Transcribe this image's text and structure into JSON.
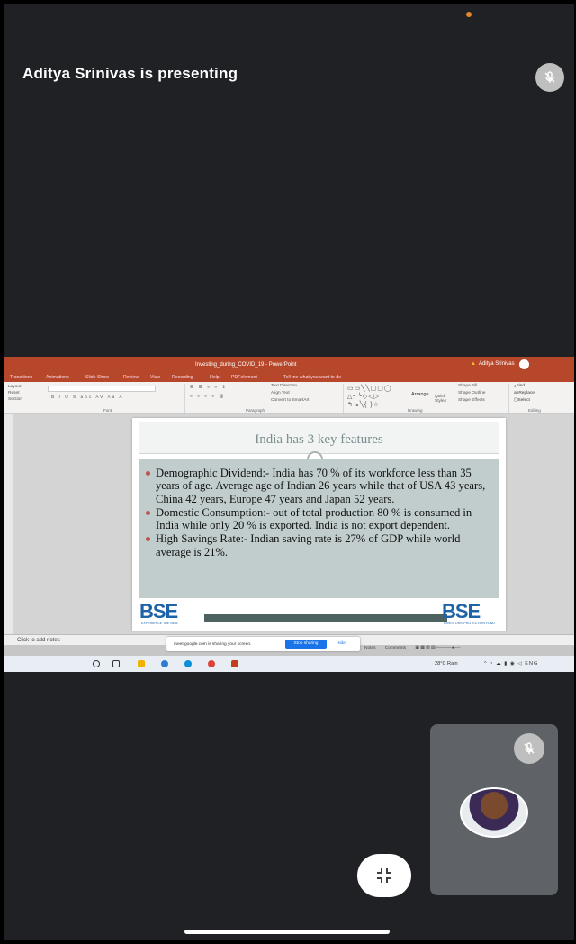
{
  "meeting": {
    "presenter_text": "Aditya Srinivas is presenting"
  },
  "shared_screen": {
    "window_title": "Investing_during_COVID_19 - PowerPoint",
    "user": "Aditya Srinivas",
    "ribbon_tabs": [
      "Transitions",
      "Animations",
      "Slide Show",
      "Review",
      "View",
      "Recording",
      "Help",
      "PDFelement",
      "Tell me what you want to do"
    ],
    "ribbon_left": [
      "Layout",
      "Reset",
      "Section"
    ],
    "ribbon_groups": [
      "Font",
      "Paragraph",
      "Drawing",
      "Editing"
    ],
    "ribbon_items": {
      "text_direction": "Text Direction",
      "align_text": "Align Text",
      "smartart": "Convert to SmartArt",
      "arrange": "Arrange",
      "quick_styles": "Quick Styles",
      "shape_fill": "Shape Fill",
      "shape_outline": "Shape Outline",
      "shape_effects": "Shape Effects",
      "find": "Find",
      "replace": "Replace",
      "select": "Select"
    },
    "slide": {
      "title": "India has 3 key features",
      "bullets": [
        "Demographic Dividend:- India has 70 % of its workforce less than 35 years of age. Average age of Indian 26 years while that of USA 43 years, China 42 years, Europe 47 years and Japan 52 years.",
        "Domestic Consumption:- out of total production 80 % is consumed in India while only 20 % is exported. India is not export dependent.",
        "High Savings Rate:- Indian saving rate is 27% of GDP while world average is 21%."
      ],
      "logo_left": "BSE",
      "logo_left_sub": "EXPERIENCE THE NEW",
      "logo_right": "BSE",
      "logo_right_sub": "INVESTORS' PROTECTION FUND"
    },
    "notes_placeholder": "Click to add notes",
    "share_notice": "meet.google.com is sharing your screen.",
    "stop_sharing": "Stop sharing",
    "hide": "Hide",
    "status_items": [
      "Notes",
      "Comments"
    ],
    "weather": "28°C Rain",
    "language": "ENG"
  },
  "colors": {
    "powerpoint_accent": "#b7472a",
    "stop_button": "#1a73e8",
    "meet_background": "#202124"
  },
  "icons": [
    "mic-off-icon",
    "collapse-icon",
    "avatar"
  ]
}
